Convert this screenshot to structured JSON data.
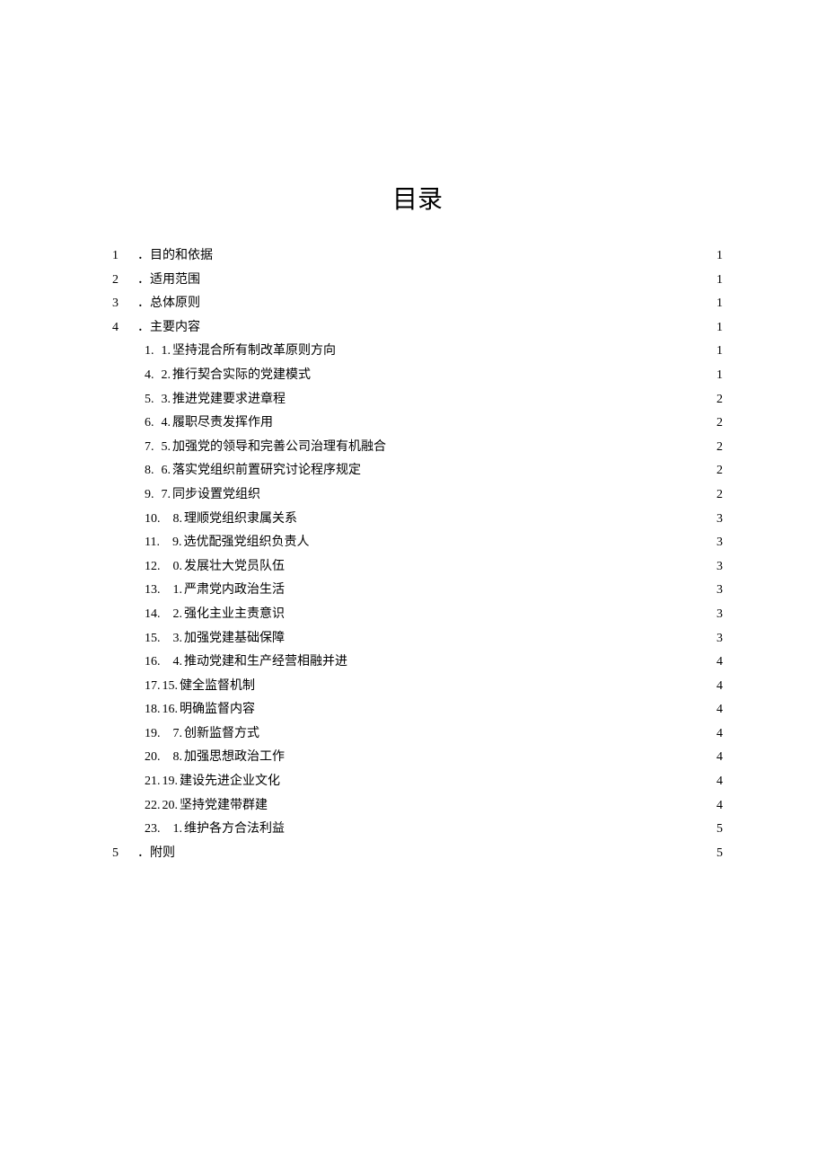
{
  "title": "目录",
  "top": [
    {
      "num": "1",
      "prefix": "．",
      "label": "目的和依据",
      "page": "1"
    },
    {
      "num": "2",
      "prefix": "．",
      "label": "适用范围 ",
      "page": "1"
    },
    {
      "num": "3",
      "prefix": "．",
      "label": "总体原则",
      "page": "1"
    },
    {
      "num": "4",
      "prefix": "．",
      "label": "主要内容 ",
      "page": "1"
    }
  ],
  "sub": [
    {
      "num": "1.",
      "prefix": "1.",
      "label": "坚持混合所有制改革原则方向",
      "page": "1"
    },
    {
      "num": "4.",
      "prefix": "2.",
      "label": "推行契合实际的党建模式",
      "page": "1"
    },
    {
      "num": "5.",
      "prefix": "3.",
      "label": "推进党建要求进章程",
      "page": "2"
    },
    {
      "num": "6.",
      "prefix": "4.",
      "label": "履职尽责发挥作用",
      "page": "2"
    },
    {
      "num": "7.",
      "prefix": "5.",
      "label": "加强党的领导和完善公司治理有机融合",
      "page": "2"
    },
    {
      "num": "8.",
      "prefix": "6.",
      "label": "落实党组织前置研究讨论程序规定",
      "page": "2"
    },
    {
      "num": "9.",
      "prefix": "7.",
      "label": "同步设置党组织",
      "page": "2"
    },
    {
      "num": "10.",
      "prefix": "8.",
      "label": "理顺党组织隶属关系",
      "page": "3"
    },
    {
      "num": "11.",
      "prefix": "9.",
      "label": "选优配强党组织负责人",
      "page": "3"
    },
    {
      "num": "12.",
      "prefix": "0.",
      "label": "发展壮大党员队伍 ",
      "page": "3"
    },
    {
      "num": "13.",
      "prefix": "1.",
      "label": "严肃党内政治生活 ",
      "page": "3"
    },
    {
      "num": "14.",
      "prefix": "2.",
      "label": "强化主业主责意识 ",
      "page": "3"
    },
    {
      "num": "15.",
      "prefix": "3.",
      "label": "加强党建基础保障 ",
      "page": "3"
    },
    {
      "num": "16.",
      "prefix": "4.",
      "label": "推动党建和生产经营相融并进 ",
      "page": "4"
    },
    {
      "num": "17.",
      "prefix": "15.",
      "label": "健全监督机制",
      "page": "4"
    },
    {
      "num": "18.",
      "prefix": "16.",
      "label": "明确监督内容",
      "page": "4"
    },
    {
      "num": "19.",
      "prefix": "7.",
      "label": "创新监督方式 ",
      "page": "4"
    },
    {
      "num": "20.",
      "prefix": "8.",
      "label": "加强思想政治工作 ",
      "page": "4"
    },
    {
      "num": "21.",
      "prefix": "19.",
      "label": "建设先进企业文化",
      "page": "4"
    },
    {
      "num": "22.",
      "prefix": "20.",
      "label": "坚持党建带群建",
      "page": "4"
    },
    {
      "num": "23.",
      "prefix": "1.",
      "label": "维护各方合法利益 ",
      "page": "5"
    }
  ],
  "bottom": [
    {
      "num": "5",
      "prefix": "．",
      "label": "附则",
      "page": "5"
    }
  ]
}
